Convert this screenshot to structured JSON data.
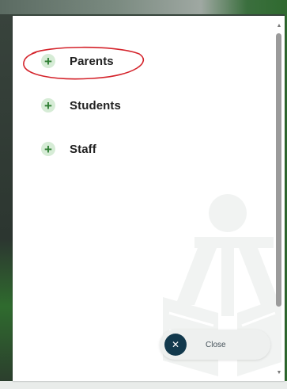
{
  "menu": {
    "items": [
      {
        "label": "Parents",
        "icon": "plus-icon",
        "highlighted": true
      },
      {
        "label": "Students",
        "icon": "plus-icon"
      },
      {
        "label": "Staff",
        "icon": "plus-icon"
      }
    ]
  },
  "close_button": {
    "icon": "close-icon",
    "label": "Close"
  },
  "scrollbar": {
    "up_icon": "triangle-up-icon",
    "down_icon": "triangle-down-icon"
  },
  "colors": {
    "highlight_ring": "#d4222a",
    "plus_bg": "#d6ecd6",
    "plus_fg": "#2e7d32",
    "close_circle": "#12394d",
    "close_pill_bg": "#eef0ef"
  }
}
